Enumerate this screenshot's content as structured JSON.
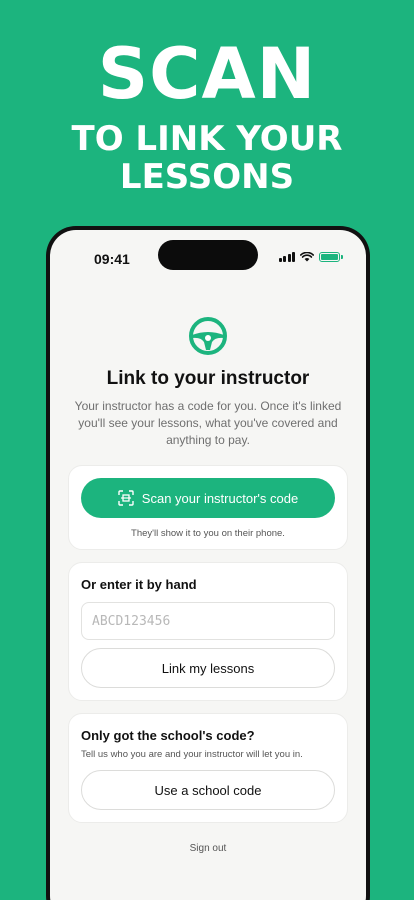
{
  "promo": {
    "headline": "SCAN",
    "subheadline_line1": "TO LINK YOUR",
    "subheadline_line2": "LESSONS"
  },
  "status_bar": {
    "time": "09:41",
    "icons": [
      "cellular-signal-icon",
      "wifi-icon",
      "battery-charging-icon"
    ]
  },
  "page": {
    "icon": "steering-wheel-icon",
    "title": "Link to your instructor",
    "intro": "Your instructor has a code for you. Once it's linked you'll see your lessons, what you've covered and anything to pay."
  },
  "scan_card": {
    "button_label": "Scan your instructor's code",
    "button_icon": "qr-scan-icon",
    "hint": "They'll show it to you on their phone."
  },
  "manual_card": {
    "heading": "Or enter it by hand",
    "input_placeholder": "ABCD123456",
    "input_value": "",
    "button_label": "Link my lessons"
  },
  "school_card": {
    "heading": "Only got the school's code?",
    "description": "Tell us who you are and your instructor will let you in.",
    "button_label": "Use a school code"
  },
  "footer": {
    "sign_out_label": "Sign out"
  },
  "colors": {
    "brand_green": "#1cb47e",
    "background": "#f6f6f4",
    "text_primary": "#111111",
    "text_secondary": "#6f6f6f"
  }
}
